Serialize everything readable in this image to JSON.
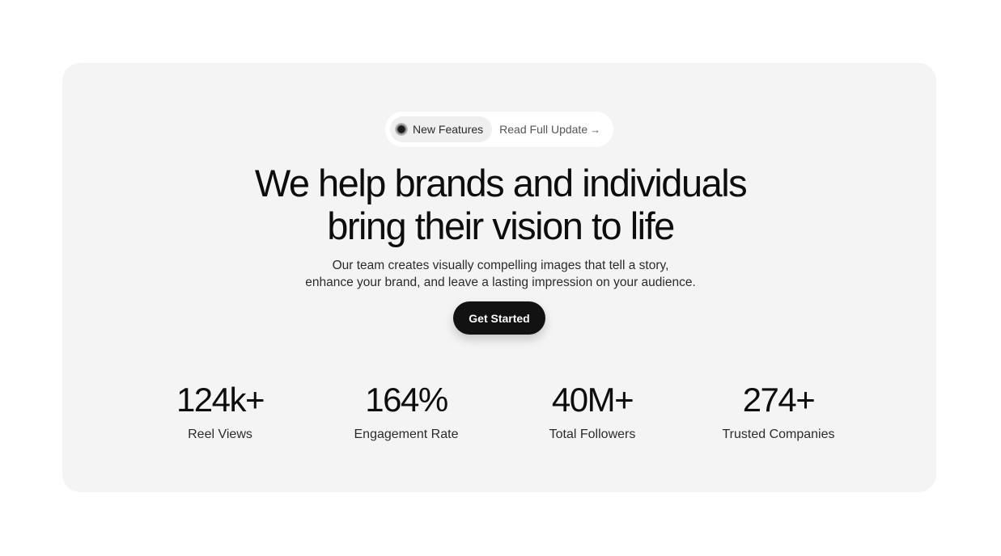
{
  "badge": {
    "tag_label": "New Features",
    "link_label": "Read Full Update",
    "link_icon": "arrow-right-icon",
    "dot_icon": "status-dot-icon"
  },
  "hero": {
    "headline_line1": "We help brands and individuals",
    "headline_line2": "bring their vision to life",
    "subtext_line1": "Our team creates visually compelling images that tell a story,",
    "subtext_line2": "enhance your brand, and leave a lasting impression on your audience.",
    "cta_label": "Get Started"
  },
  "stats": [
    {
      "value": "124k+",
      "label": "Reel Views"
    },
    {
      "value": "164%",
      "label": "Engagement Rate"
    },
    {
      "value": "40M+",
      "label": "Total Followers"
    },
    {
      "value": "274+",
      "label": "Trusted Companies"
    }
  ],
  "colors": {
    "page_background": "#ffffff",
    "card_background": "#f4f4f4",
    "button_background": "#121212",
    "button_text": "#ffffff"
  }
}
